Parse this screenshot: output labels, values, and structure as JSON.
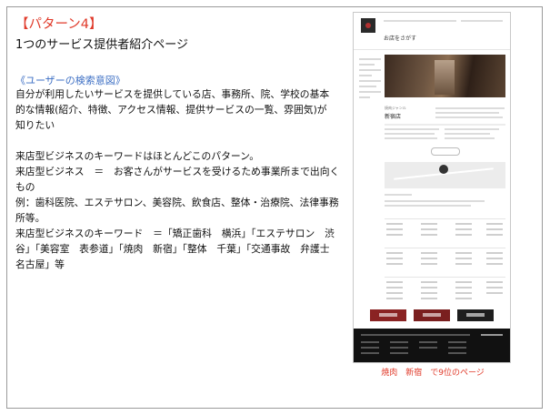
{
  "slide": {
    "pattern_label": "【パターン4】",
    "subtitle": "1つのサービス提供者紹介ページ",
    "intent_heading": "《ユーザーの検索意図》",
    "intent_body": "自分が利用したいサービスを提供している店、事務所、院、学校の基本的な情報(紹介、特徴、アクセス情報、提供サービスの一覧、雰囲気)が知りたい",
    "line1": "来店型ビジネスのキーワードはほとんどこのパターン。",
    "line2": "来店型ビジネス　＝　お客さんがサービスを受けるため事業所まで出向くもの",
    "line3": "例：歯科医院、エステサロン、美容院、飲食店、整体・治療院、法律事務所等。",
    "line4": "来店型ビジネスのキーワード　＝「矯正歯科　横浜」「エステサロン　渋谷」「美容室　表参道」「焼肉　新宿」「整体　千葉」「交通事故　弁護士　名古屋」等",
    "caption": "焼肉　新宿　で9位のページ"
  },
  "thumbnail": {
    "site_title": "お店をさがす",
    "shop_category": "焼肉ジャンル",
    "shop_name": "新宿店",
    "colors": {
      "accent": "#e03a2a",
      "link": "#3d6fc4",
      "footer": "#111111"
    }
  }
}
